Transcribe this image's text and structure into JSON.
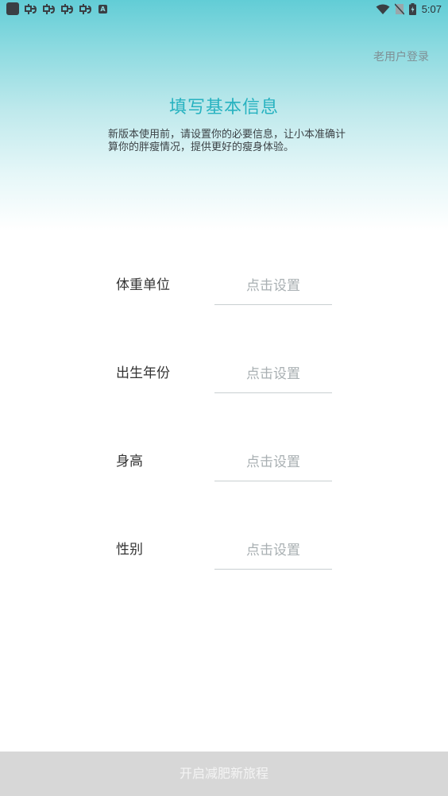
{
  "status_bar": {
    "time": "5:07",
    "icons": [
      "app-square-icon",
      "bug-icon",
      "bug-icon",
      "bug-icon",
      "bug-icon",
      "a-icon",
      "wifi-icon",
      "no-sim-icon",
      "battery-icon"
    ]
  },
  "header": {
    "old_user_login": "老用户登录",
    "title": "填写基本信息",
    "subtitle": "新版本使用前，请设置你的必要信息，让小本准确计算你的胖瘦情况，提供更好的瘦身体验。"
  },
  "form": {
    "rows": [
      {
        "label": "体重单位",
        "placeholder": "点击设置"
      },
      {
        "label": "出生年份",
        "placeholder": "点击设置"
      },
      {
        "label": "身高",
        "placeholder": "点击设置"
      },
      {
        "label": "性别",
        "placeholder": "点击设置"
      }
    ]
  },
  "footer": {
    "start_button": "开启减肥新旅程"
  },
  "colors": {
    "accent": "#27b2c0",
    "button_disabled": "#d7d7d7"
  }
}
